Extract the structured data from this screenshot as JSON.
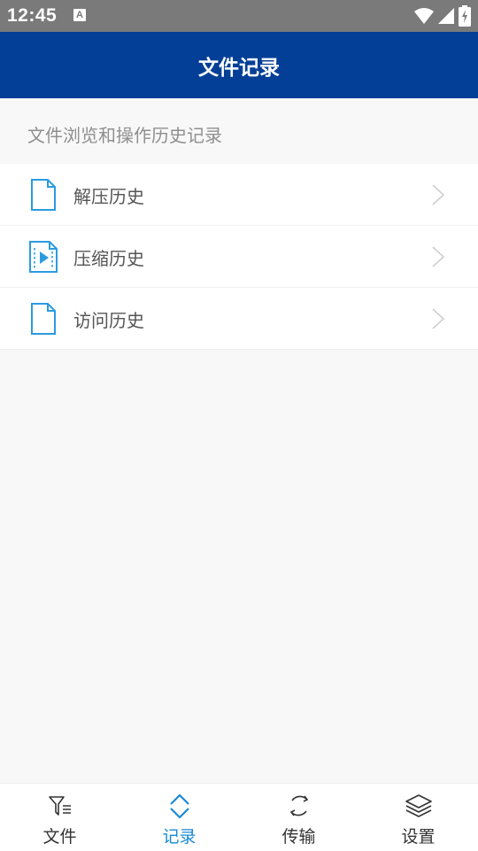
{
  "status_bar": {
    "time": "12:45",
    "notification_icon": "A"
  },
  "app_bar": {
    "title": "文件记录"
  },
  "subtitle": "文件浏览和操作历史记录",
  "list": [
    {
      "label": "解压历史",
      "icon": "document-icon"
    },
    {
      "label": "压缩历史",
      "icon": "video-file-icon"
    },
    {
      "label": "访问历史",
      "icon": "document-icon"
    }
  ],
  "bottom_nav": [
    {
      "label": "文件",
      "icon": "filter-list-icon",
      "active": false
    },
    {
      "label": "记录",
      "icon": "chevron-up-down-icon",
      "active": true
    },
    {
      "label": "传输",
      "icon": "sync-icon",
      "active": false
    },
    {
      "label": "设置",
      "icon": "layers-icon",
      "active": false
    }
  ],
  "colors": {
    "app_bar": "#033f96",
    "accent": "#1a8ad4",
    "icon_blue": "#2b9be0",
    "status_bar": "#7a7a7a",
    "background": "#f8f8f8"
  }
}
